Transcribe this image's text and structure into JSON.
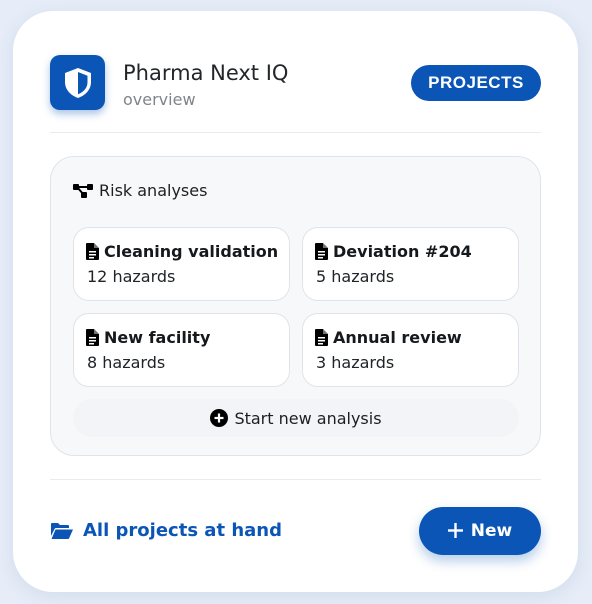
{
  "header": {
    "icon": "shield-icon",
    "title": "Pharma Next IQ",
    "subtitle": "overview",
    "projects_label": "PROJECTS"
  },
  "risk_panel": {
    "icon": "share-nodes-icon",
    "title": "Risk analyses",
    "analyses": [
      {
        "name": "Cleaning validation",
        "hazards": "12 hazards",
        "icon": "document-icon"
      },
      {
        "name": "Deviation #204",
        "hazards": "5 hazards",
        "icon": "document-icon"
      },
      {
        "name": "New facility",
        "hazards": "8 hazards",
        "icon": "document-icon"
      },
      {
        "name": "Annual review",
        "hazards": "3 hazards",
        "icon": "document-icon"
      }
    ],
    "start_label": "Start new analysis",
    "start_icon": "plus-circle-icon"
  },
  "footer": {
    "link_icon": "folder-open-icon",
    "link_label": "All projects at hand",
    "new_icon": "plus-icon",
    "new_label": "New"
  },
  "colors": {
    "accent": "#0b55b7",
    "background": "#e6edf8",
    "card": "#ffffff",
    "panel": "#f7f8fa"
  }
}
